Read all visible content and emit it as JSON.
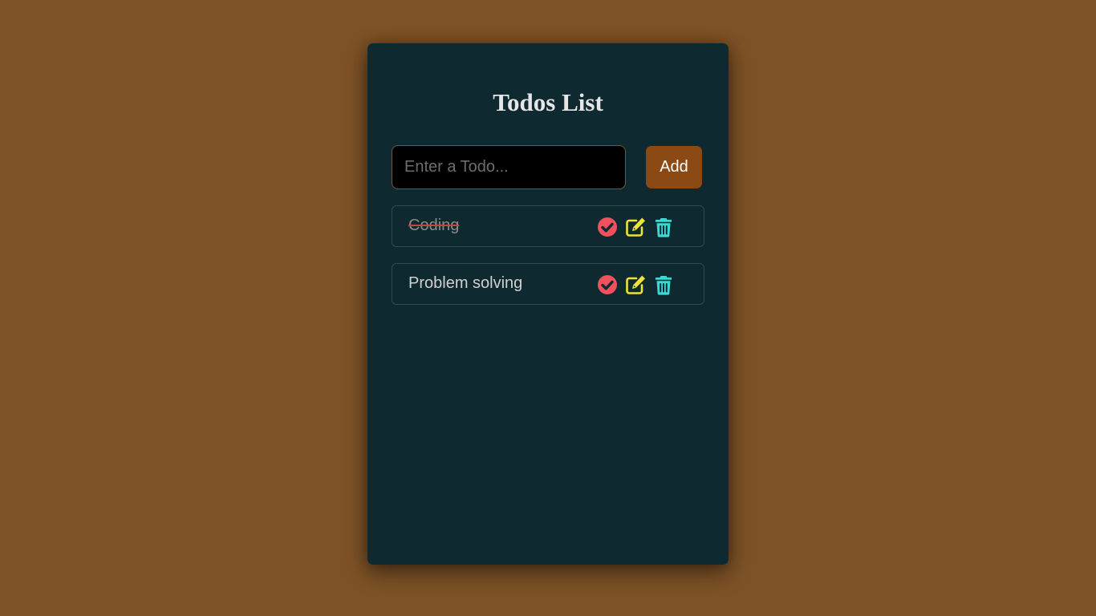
{
  "header": {
    "title": "Todos List"
  },
  "form": {
    "input_placeholder": "Enter a Todo...",
    "input_value": "",
    "add_label": "Add"
  },
  "todos": [
    {
      "text": "Coding",
      "completed": true
    },
    {
      "text": "Problem solving",
      "completed": false
    }
  ],
  "icons": {
    "complete": "check-circle-icon",
    "edit": "edit-icon",
    "delete": "trash-icon"
  },
  "colors": {
    "background": "#7d5226",
    "card": "#0f2930",
    "add_button": "#8b4a14",
    "check_icon": "#f0515c",
    "edit_icon": "#f0e23a",
    "trash_icon": "#3ed8d3"
  }
}
